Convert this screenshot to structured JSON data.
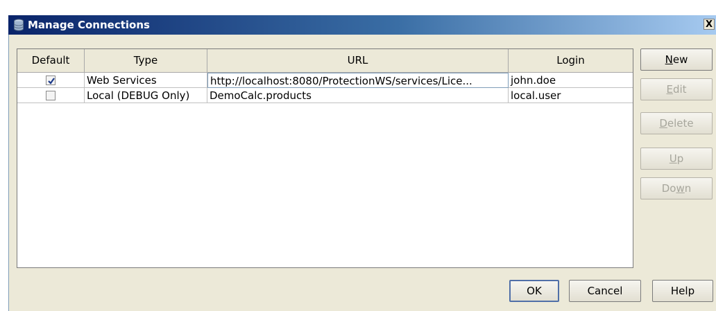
{
  "window": {
    "title": "Manage Connections",
    "close_label": "X"
  },
  "table": {
    "columns": [
      "Default",
      "Type",
      "URL",
      "Login"
    ],
    "rows": [
      {
        "default": true,
        "type": "Web Services",
        "url": "http://localhost:8080/ProtectionWS/services/Lice...",
        "login": "john.doe"
      },
      {
        "default": false,
        "type": "Local (DEBUG Only)",
        "url": "DemoCalc.products",
        "login": "local.user"
      }
    ]
  },
  "side_buttons": {
    "new": {
      "pre": "",
      "mn": "N",
      "post": "ew",
      "enabled": true
    },
    "edit": {
      "pre": "",
      "mn": "E",
      "post": "dit",
      "enabled": false
    },
    "delete": {
      "pre": "",
      "mn": "D",
      "post": "elete",
      "enabled": false
    },
    "up": {
      "pre": "",
      "mn": "U",
      "post": "p",
      "enabled": false
    },
    "down": {
      "pre": "Do",
      "mn": "w",
      "post": "n",
      "enabled": false
    }
  },
  "bottom_buttons": {
    "ok": "OK",
    "cancel": "Cancel",
    "help": "Help"
  },
  "colors": {
    "title_gradient_start": "#0a246a",
    "title_gradient_end": "#a6caf0",
    "dialog_bg": "#ece9d8",
    "default_button_border": "#506fa8"
  }
}
